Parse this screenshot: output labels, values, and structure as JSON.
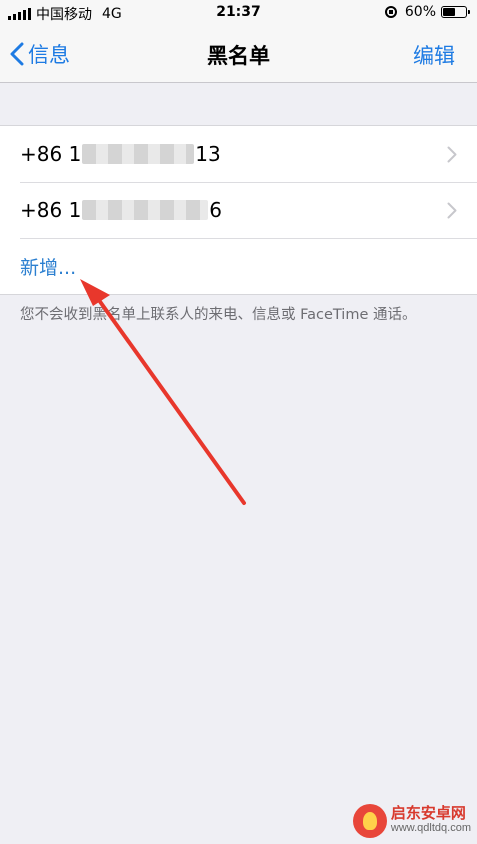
{
  "status_bar": {
    "carrier": "中国移动",
    "network": "4G",
    "time": "21:37",
    "battery_percent": "60%",
    "battery_level": 0.6
  },
  "nav": {
    "back_label": "信息",
    "title": "黑名单",
    "edit_label": "编辑"
  },
  "blocked_list": {
    "items": [
      {
        "prefix": "+86 1",
        "suffix": "13"
      },
      {
        "prefix": "+86 1",
        "suffix": "6"
      }
    ],
    "add_label": "新增..."
  },
  "footnote": "您不会收到黑名单上联系人的来电、信息或 FaceTime 通话。",
  "watermark": {
    "name": "启东安卓网",
    "url": "www.qdltdq.com"
  },
  "colors": {
    "accent": "#1e7be3",
    "arrow": "#e8372c",
    "background": "#efeff4"
  }
}
